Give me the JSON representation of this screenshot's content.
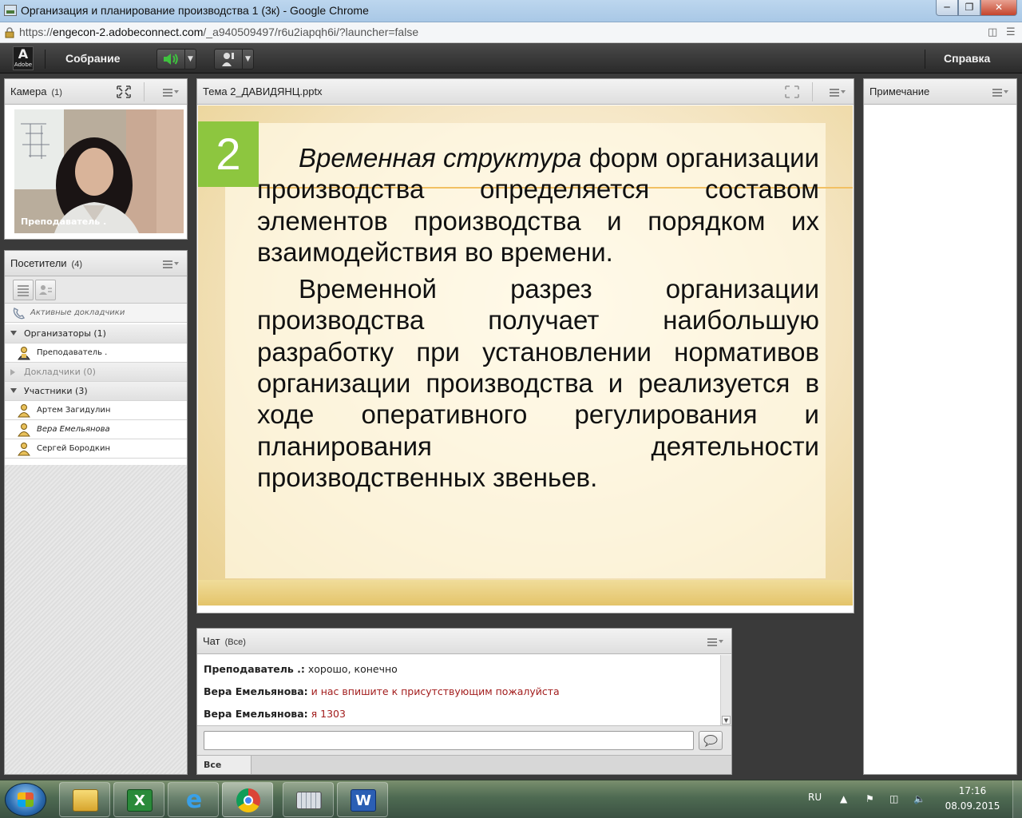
{
  "browser": {
    "window_title": "Организация и планирование производства 1 (3к) - Google Chrome",
    "url_prefix": "https://",
    "url_host": "engecon-2.adobeconnect.com",
    "url_path": "/_a940509497/r6u2iapqh6i/?launcher=false"
  },
  "appbar": {
    "logo_text": "Adobe",
    "meeting_menu": "Собрание",
    "help_menu": "Справка"
  },
  "camera_pod": {
    "title": "Камера",
    "count": "(1)",
    "video_label": "Преподаватель ."
  },
  "attendees_pod": {
    "title": "Посетители",
    "count": "(4)",
    "active_speakers_label": "Активные докладчики",
    "groups": [
      {
        "label": "Организаторы (1)",
        "expanded": true,
        "members": [
          "Преподаватель ."
        ]
      },
      {
        "label": "Докладчики (0)",
        "expanded": false,
        "members": []
      },
      {
        "label": "Участники (3)",
        "expanded": true,
        "members": [
          "Артем Загидулин",
          "Вера Емельянова",
          "Сергей Бородкин"
        ]
      }
    ]
  },
  "share_pod": {
    "title": "Тема 2_ДАВИДЯНЦ.pptx",
    "slide": {
      "number": "2",
      "para1_italic": "Временная структура",
      "para1_rest": " форм организации производства определяется составом элементов производства и порядком их взаимодействия во времени.",
      "para2": "Временной разрез организации производства получает наибольшую разработку при установлении нормативов организации производства и реализуется в ходе оперативного регулирования и планирования деятельности производственных звеньев."
    }
  },
  "notes_pod": {
    "title": "Примечание"
  },
  "chat_pod": {
    "title": "Чат",
    "scope": "(Все)",
    "messages": [
      {
        "author": "Преподаватель .:",
        "text": "хорошо, конечно",
        "highlight": false
      },
      {
        "author": "Вера Емельянова:",
        "text": "и нас впишите к присутствующим пожалуйста",
        "highlight": true
      },
      {
        "author": "Вера Емельянова:",
        "text": "я 1303",
        "highlight": true
      }
    ],
    "tab_all": "Все"
  },
  "taskbar": {
    "language": "RU",
    "time": "17:16",
    "date": "08.09.2015",
    "apps": [
      "file-explorer",
      "excel",
      "internet-explorer",
      "chrome",
      "on-screen-keyboard",
      "word"
    ]
  },
  "colors": {
    "chat_highlight": "#a21d1d",
    "slide_number_bg": "#8dc63f",
    "slide_accent_line": "#f2c063"
  }
}
